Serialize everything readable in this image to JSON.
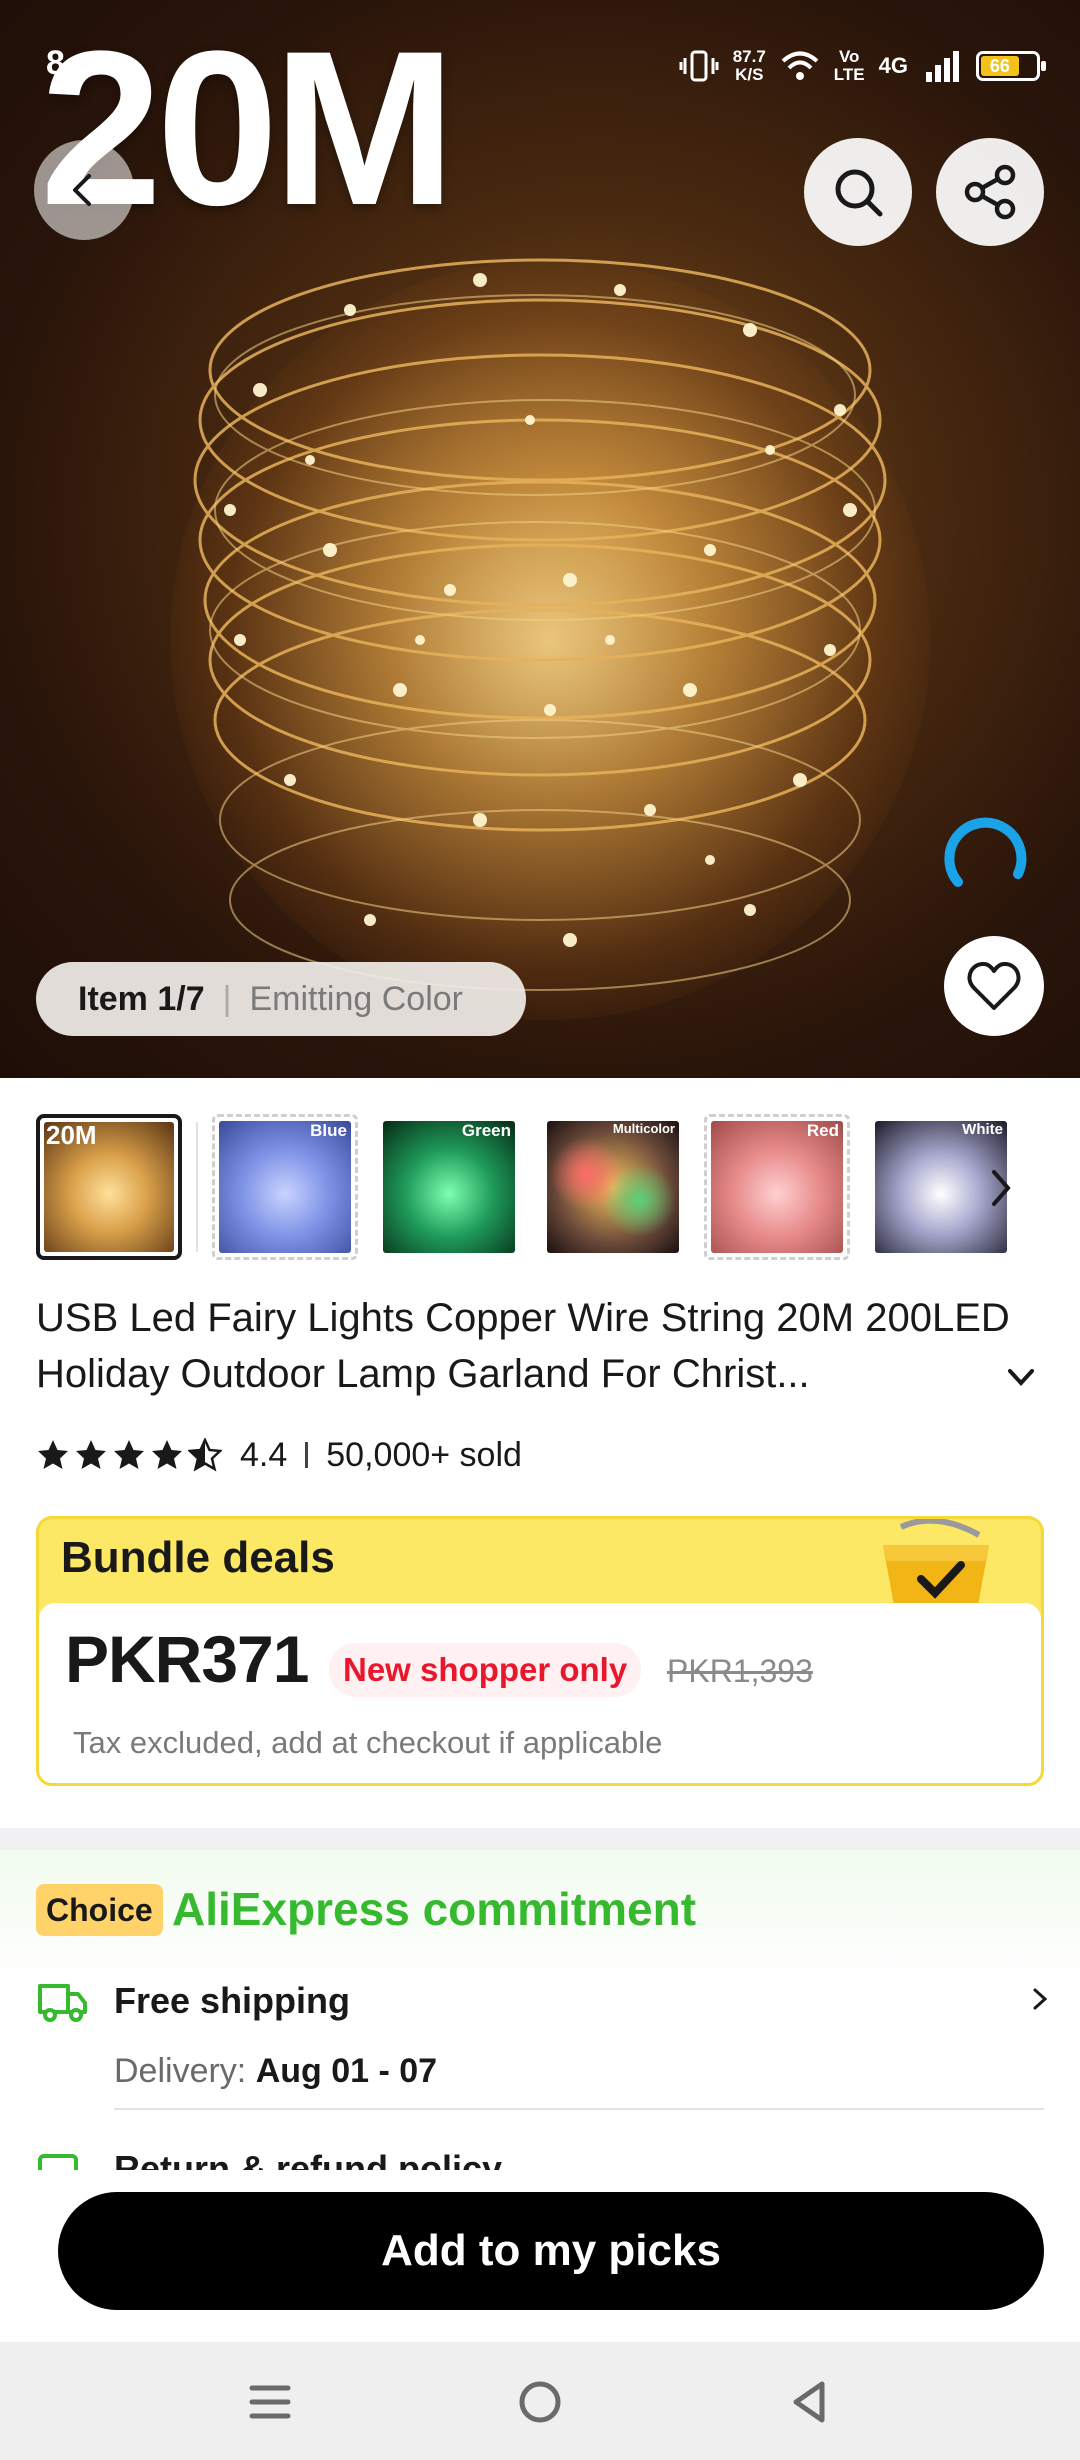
{
  "status_bar": {
    "time": "8",
    "net_speed": "87.7",
    "net_unit": "K/S",
    "volte": "Vo",
    "volte_sub": "LTE",
    "network": "4G",
    "battery": "66"
  },
  "hero": {
    "overlay_text": "20M",
    "item_counter": "Item 1/7",
    "variant_label": "Emitting Color"
  },
  "thumbnails": [
    {
      "label": "20M",
      "tint": "#d9a04a",
      "selected": true
    },
    {
      "label": "Blue",
      "tint": "#7d92e6",
      "selected": false
    },
    {
      "label": "Green",
      "tint": "#1f9a5a",
      "selected": false
    },
    {
      "label": "Multicolor",
      "tint": "#9b6b4a",
      "selected": false
    },
    {
      "label": "Red",
      "tint": "#e78a8a",
      "selected": false
    },
    {
      "label": "White",
      "tint": "#7a7aa0",
      "selected": false
    }
  ],
  "product": {
    "title": "USB Led Fairy Lights Copper Wire String 20M 200LED Holiday Outdoor Lamp Garland For Christ...",
    "rating": "4.4",
    "sold": "50,000+ sold",
    "stars": 4.4
  },
  "bundle": {
    "heading": "Bundle deals",
    "price": "PKR371",
    "badge": "New shopper only",
    "original_price": "PKR1,393",
    "tax_note": "Tax excluded, add at checkout if applicable"
  },
  "commitment": {
    "badge": "Choice",
    "title": "AliExpress commitment",
    "shipping_title": "Free shipping",
    "delivery_label": "Delivery: ",
    "delivery_date": "Aug 01 - 07",
    "returns_title": "Return & refund policy"
  },
  "cta": {
    "label": "Add to my picks"
  },
  "colors": {
    "accent_green": "#36b92f",
    "price_red": "#e8172c",
    "bundle_yellow": "#fde865",
    "loader_blue": "#1aa3e8"
  },
  "icons": [
    "back-arrow-icon",
    "search-icon",
    "share-icon",
    "heart-icon",
    "loading-spinner-icon",
    "chevron-right-icon",
    "chevron-down-icon",
    "star-icon",
    "truck-icon",
    "cart-icon",
    "menu-icon",
    "home-icon",
    "back-icon"
  ]
}
